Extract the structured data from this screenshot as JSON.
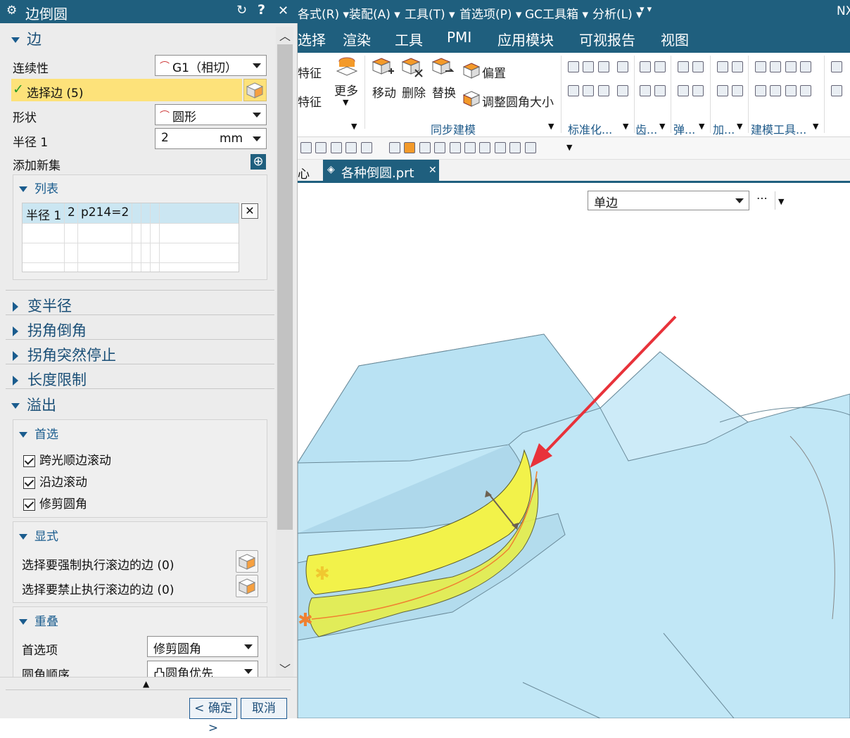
{
  "dialog": {
    "title": "边倒圆",
    "edge_section": "边",
    "continuity_label": "连续性",
    "continuity_value": "G1（相切）",
    "select_edge_label": "选择边 (5)",
    "shape_label": "形状",
    "shape_value": "圆形",
    "radius_label": "半径 1",
    "radius_value": "2",
    "radius_unit": "mm",
    "add_set_label": "添加新集",
    "list_section": "列表",
    "list_rows": [
      {
        "name": "半径 1",
        "value": "2",
        "expr": "p214=2"
      }
    ],
    "collapsed_sections": [
      "变半径",
      "拐角倒角",
      "拐角突然停止",
      "长度限制"
    ],
    "overflow_section": "溢出",
    "preference_section": "首选",
    "preference_checks": [
      "跨光顺边滚动",
      "沿边滚动",
      "修剪圆角"
    ],
    "explicit_section": "显式",
    "explicit_force": "选择要强制执行滚边的边 (0)",
    "explicit_forbid": "选择要禁止执行滚边的边 (0)",
    "overlap_section": "重叠",
    "pref_option_label": "首选项",
    "pref_option_value": "修剪圆角",
    "fillet_order_label": "圆角顺序",
    "fillet_order_value": "凸圆角优先",
    "ok_label": "< 确定 >",
    "cancel_label": "取消"
  },
  "app": {
    "menu": [
      "各式(R)",
      "装配(A)",
      "工具(T)",
      "首选项(P)",
      "GC工具箱",
      "分析(L)"
    ],
    "menu_right": "NX",
    "ribbon_tabs": [
      "选择",
      "渲染",
      "工具",
      "PMI",
      "应用模块",
      "可视报告",
      "视图"
    ],
    "left_partial": [
      "特征",
      "特征"
    ],
    "more_label": "更多",
    "sync_buttons": [
      "移动",
      "删除",
      "替换"
    ],
    "offset_label": "偏置",
    "resize_label": "调整圆角大小",
    "groups": [
      "同步建模",
      "标准化...",
      "齿...",
      "弹...",
      "加...",
      "建模工具..."
    ],
    "doc_tab_partial": "心",
    "doc_tab": "各种倒圆.prt",
    "selection_filter": "单边"
  },
  "colors": {
    "titlebar": "#1f5f7e",
    "selected_row": "#fde27a",
    "model": "#c1e7f6",
    "fillet": "#f2f24a",
    "arrow": "#e8323a"
  }
}
